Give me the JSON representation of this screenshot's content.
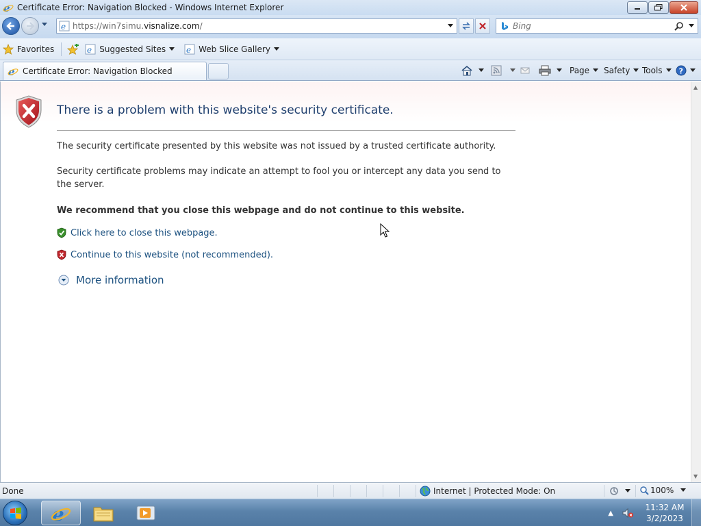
{
  "window": {
    "title": "Certificate Error: Navigation Blocked - Windows Internet Explorer"
  },
  "navbar": {
    "url_prefix": "https://win7simu.",
    "url_domain": "visnalize.com",
    "url_suffix": "/",
    "search_placeholder": "Bing"
  },
  "favorites_bar": {
    "favorites_label": "Favorites",
    "items": [
      {
        "label": "Suggested Sites"
      },
      {
        "label": "Web Slice Gallery"
      }
    ]
  },
  "tabs": [
    {
      "label": "Certificate Error: Navigation Blocked"
    }
  ],
  "commands": {
    "page": "Page",
    "safety": "Safety",
    "tools": "Tools"
  },
  "page": {
    "heading": "There is a problem with this website's security certificate.",
    "paragraph1": "The security certificate presented by this website was not issued by a trusted certificate authority.",
    "paragraph2": "Security certificate problems may indicate an attempt to fool you or intercept any data you send to the server.",
    "recommendation": "We recommend that you close this webpage and do not continue to this website.",
    "close_link": "Click here to close this webpage.",
    "continue_link": "Continue to this website (not recommended).",
    "more_info": "More information"
  },
  "statusbar": {
    "status": "Done",
    "zone": "Internet | Protected Mode: On",
    "zoom": "100%"
  },
  "taskbar": {
    "time": "11:32 AM",
    "date": "3/2/2023"
  },
  "colors": {
    "link": "#1c5180",
    "heading": "#1f3f6e",
    "error_red": "#c0262c",
    "ok_green": "#3a8f2c"
  }
}
